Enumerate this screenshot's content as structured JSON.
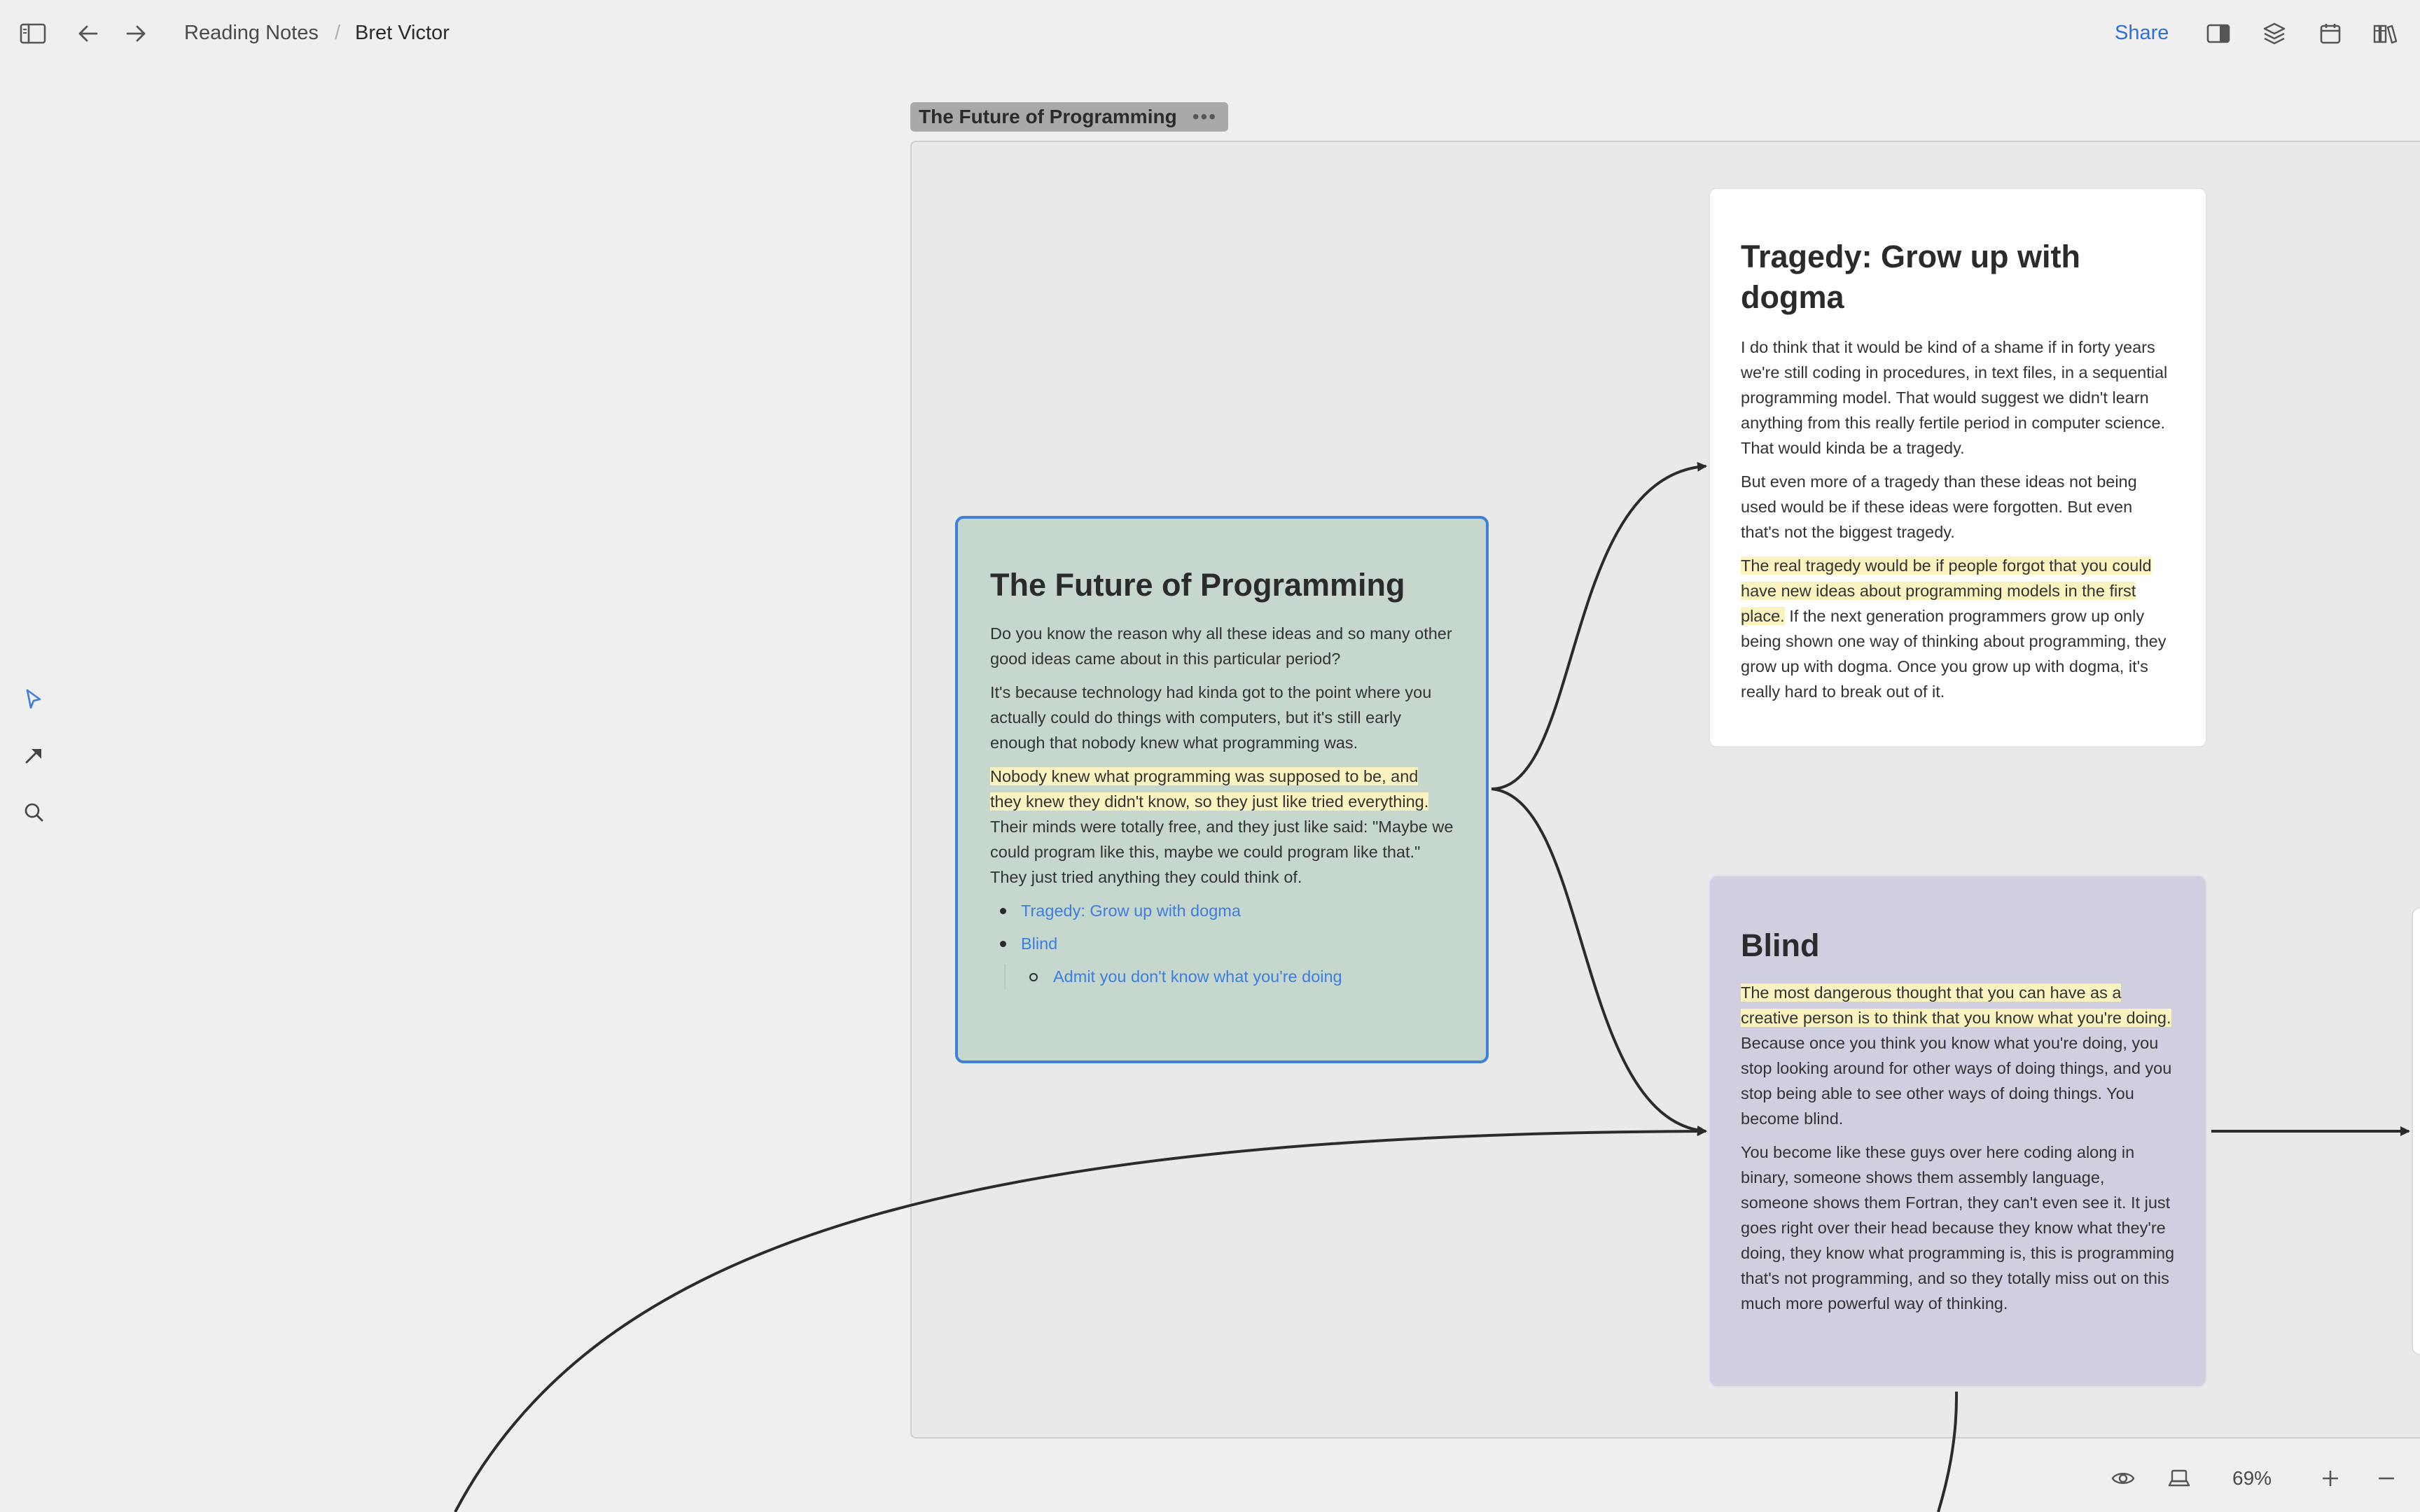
{
  "header": {
    "breadcrumb": [
      "Reading Notes",
      "Bret Victor"
    ],
    "share_label": "Share"
  },
  "icons": {
    "sidebar_toggle": "sidebar-icon",
    "back": "arrow-left-icon",
    "forward": "arrow-right-icon",
    "panel": "panel-icon",
    "layers": "layers-icon",
    "calendar": "calendar-icon",
    "library": "library-icon",
    "select_tool": "cursor-icon",
    "connect_tool": "arrow-tool-icon",
    "search_tool": "search-icon",
    "preview": "eye-icon",
    "present": "laptop-icon",
    "zoom_in": "plus-icon",
    "zoom_out": "minus-icon"
  },
  "group": {
    "title": "The Future of Programming",
    "menu": "•••"
  },
  "cards": {
    "main": {
      "title": "The Future of Programming",
      "p1": "Do you know the reason why all these ideas and so many other good ideas came about in this particular period?",
      "p2": "It's because technology had kinda got to the point where you actually could do things with computers, but it's still early enough that nobody knew what programming was.",
      "p3_highlight": "Nobody knew what programming was supposed to be, and they knew they didn't know, so they just like tried everything.",
      "p3_rest": " Their minds were totally free, and they just like said: \"Maybe we could program like this, maybe we could program like that.\" They just tried anything they could think of.",
      "links": [
        "Tragedy: Grow up with dogma",
        "Blind",
        "Admit you don't know what you're doing"
      ]
    },
    "tragedy": {
      "title": "Tragedy: Grow up with dogma",
      "p1": "I do think that it would be kind of a shame if in forty years we're still coding in procedures, in text files, in a sequential programming model. That would suggest we didn't learn anything from this really fertile period in computer science. That would kinda be a tragedy.",
      "p2": "But even more of a tragedy than these ideas not being used would be if these ideas were forgotten. But even that's not the biggest tragedy.",
      "p3_highlight": "The real tragedy would be if people forgot that you could have new ideas about programming models in the first place.",
      "p3_rest": " If the next generation programmers grow up only being shown one way of thinking about programming, they grow up with dogma. Once you grow up with dogma, it's really hard to break out of it."
    },
    "blind": {
      "title": "Blind",
      "p1_highlight": "The most dangerous thought that you can have as a creative person is to think that you know what you're doing.",
      "p1_rest": " Because once you think you know what you're doing, you stop looking around for other ways of doing things, and you stop being able to see other ways of doing things. You become blind.",
      "p2": "You become like these guys over here coding along in binary, someone shows them assembly language, someone shows them Fortran, they can't even see it. It just goes right over their head because they know what they're doing, they know what programming is, this is programming that's not programming, and so they totally miss out on this much more powerful way of thinking."
    }
  },
  "footer": {
    "zoom_level": "69%"
  },
  "colors": {
    "accent": "#3d7de0",
    "highlight": "#faf3bf",
    "main_card": "#c6d8cd",
    "blind_card": "#cfcfdf"
  }
}
